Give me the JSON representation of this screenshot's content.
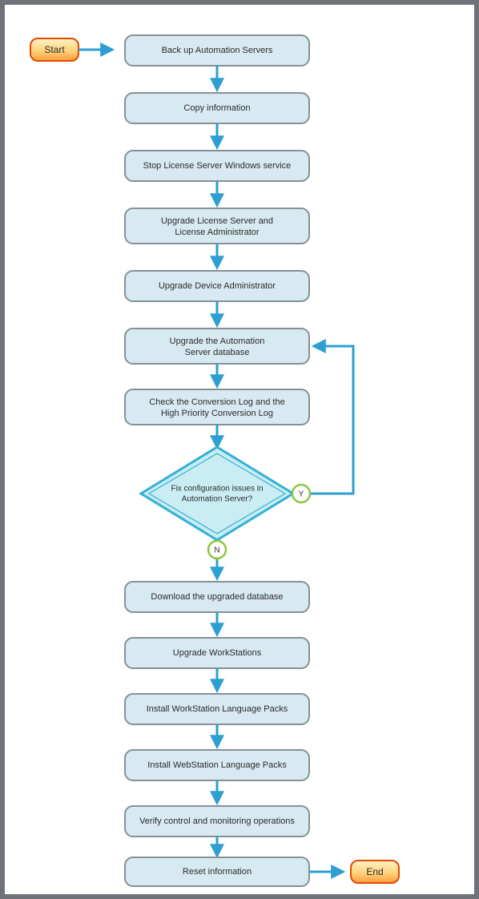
{
  "chart_data": {
    "type": "flowchart",
    "title": "",
    "nodes": [
      {
        "id": "start",
        "type": "terminal",
        "label": "Start"
      },
      {
        "id": "n1",
        "type": "process",
        "label": "Back up Automation Servers"
      },
      {
        "id": "n2",
        "type": "process",
        "label": "Copy information"
      },
      {
        "id": "n3",
        "type": "process",
        "label": "Stop License Server Windows service"
      },
      {
        "id": "n4",
        "type": "process",
        "label_lines": [
          "Upgrade License Server and",
          "License Administrator"
        ]
      },
      {
        "id": "n5",
        "type": "process",
        "label": "Upgrade Device Administrator"
      },
      {
        "id": "n6",
        "type": "process",
        "label_lines": [
          "Upgrade the Automation",
          "Server database"
        ]
      },
      {
        "id": "n7",
        "type": "process",
        "label_lines": [
          "Check the Conversion Log and the",
          "High Priority Conversion Log"
        ]
      },
      {
        "id": "d1",
        "type": "decision",
        "label_lines": [
          "Fix configuration issues in",
          "Automation Server?"
        ]
      },
      {
        "id": "n8",
        "type": "process",
        "label": "Download the upgraded database"
      },
      {
        "id": "n9",
        "type": "process",
        "label": "Upgrade WorkStations"
      },
      {
        "id": "n10",
        "type": "process",
        "label": "Install WorkStation Language Packs"
      },
      {
        "id": "n11",
        "type": "process",
        "label": "Install WebStation Language Packs"
      },
      {
        "id": "n12",
        "type": "process",
        "label": "Verify control and monitoring operations"
      },
      {
        "id": "n13",
        "type": "process",
        "label": "Reset information"
      },
      {
        "id": "end",
        "type": "terminal",
        "label": "End"
      }
    ],
    "edges": [
      {
        "from": "start",
        "to": "n1"
      },
      {
        "from": "n1",
        "to": "n2"
      },
      {
        "from": "n2",
        "to": "n3"
      },
      {
        "from": "n3",
        "to": "n4"
      },
      {
        "from": "n4",
        "to": "n5"
      },
      {
        "from": "n5",
        "to": "n6"
      },
      {
        "from": "n6",
        "to": "n7"
      },
      {
        "from": "n7",
        "to": "d1"
      },
      {
        "from": "d1",
        "to": "n6",
        "label": "Y"
      },
      {
        "from": "d1",
        "to": "n8",
        "label": "N"
      },
      {
        "from": "n8",
        "to": "n9"
      },
      {
        "from": "n9",
        "to": "n10"
      },
      {
        "from": "n10",
        "to": "n11"
      },
      {
        "from": "n11",
        "to": "n12"
      },
      {
        "from": "n12",
        "to": "n13"
      },
      {
        "from": "n13",
        "to": "end"
      }
    ],
    "branch_labels": {
      "yes": "Y",
      "no": "N"
    }
  }
}
